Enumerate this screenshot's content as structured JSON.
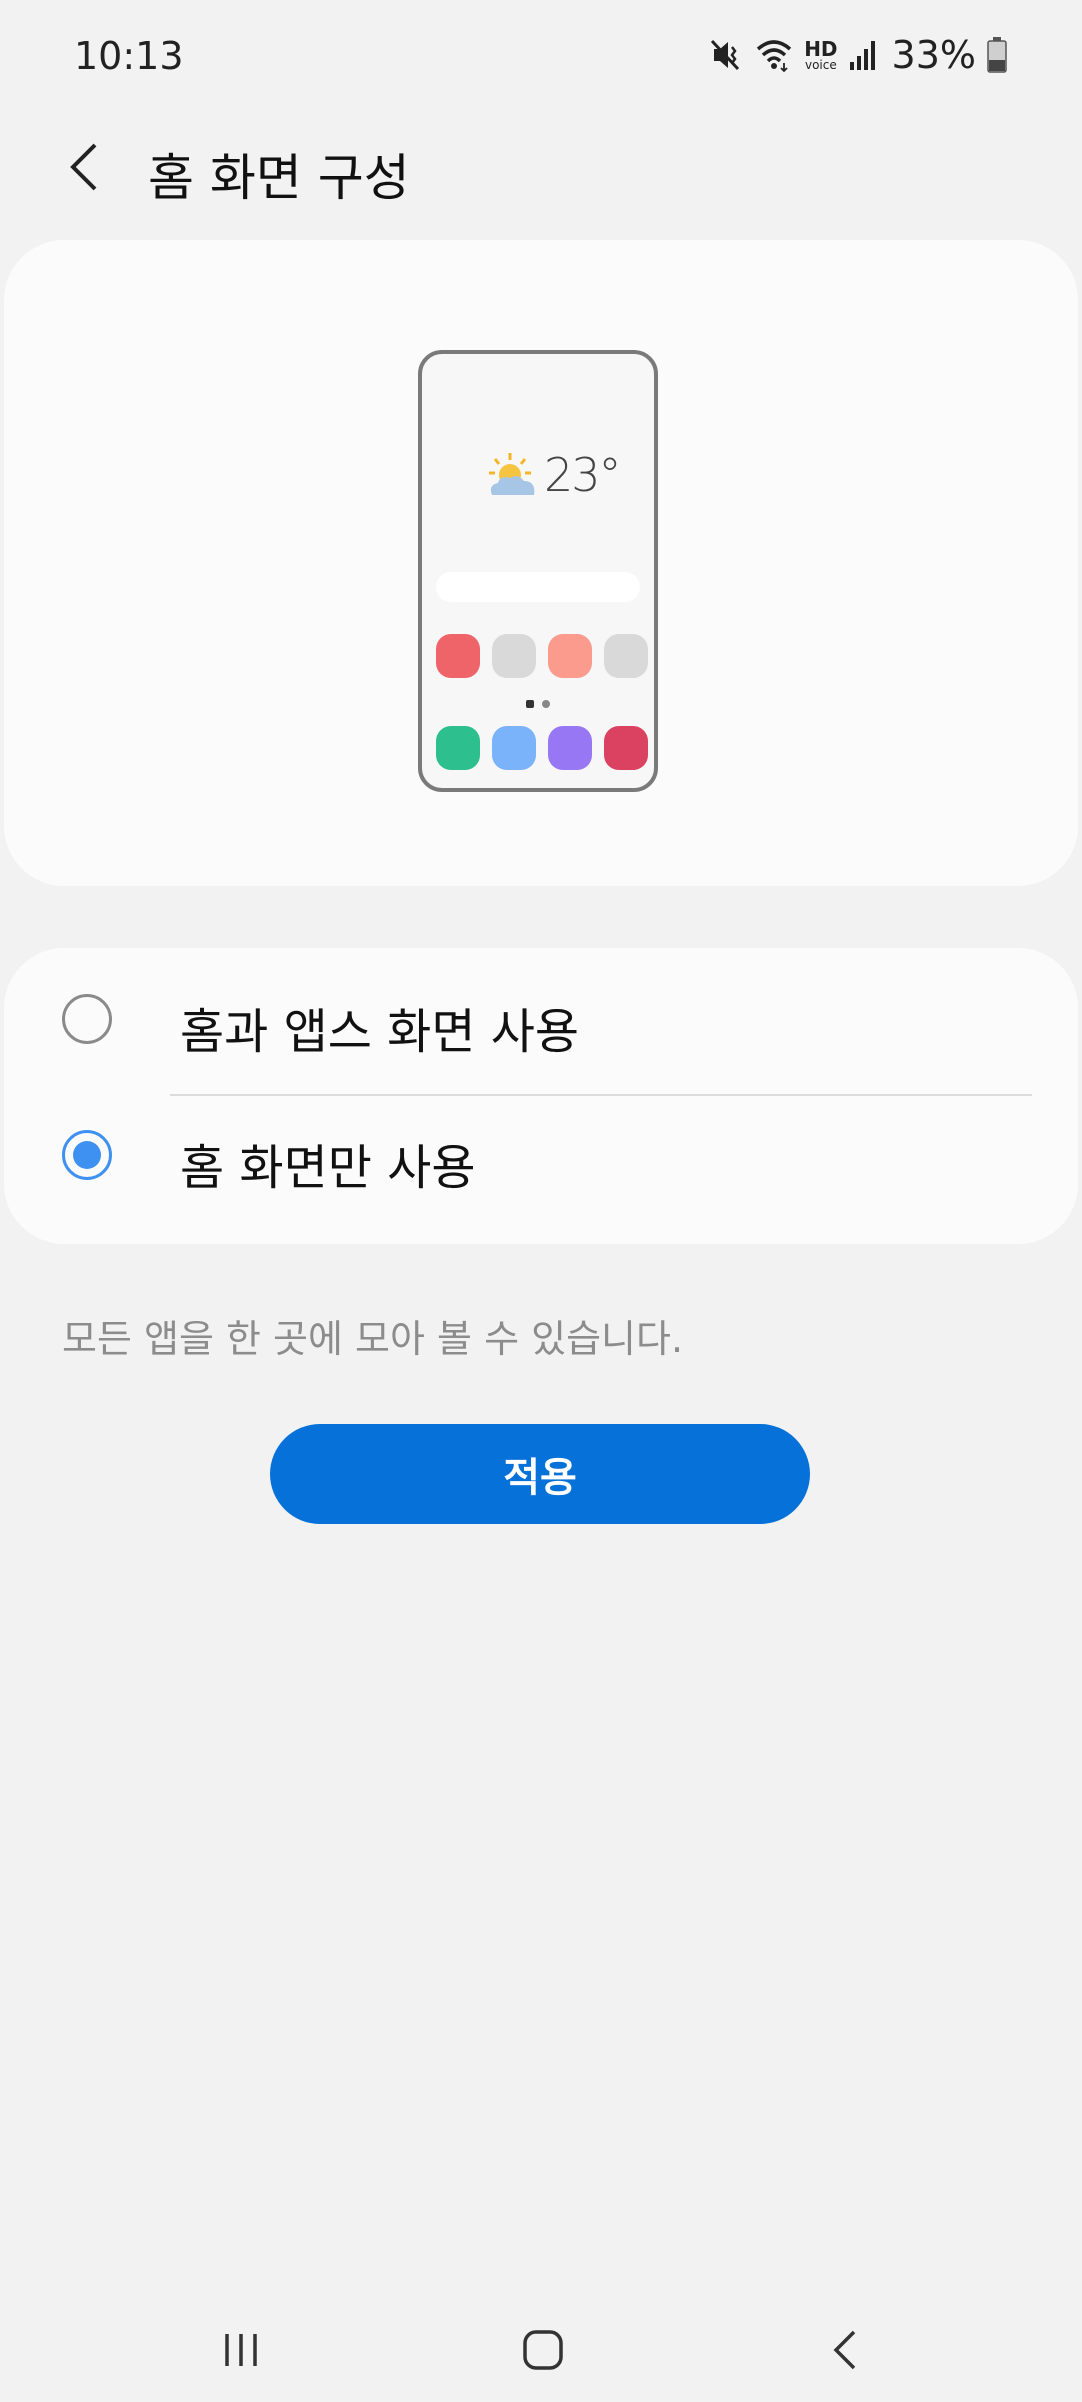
{
  "status_bar": {
    "time": "10:13",
    "hd_label": "HD",
    "voice_label": "voice",
    "battery": "33%",
    "icons": [
      "vibrate-mute-icon",
      "wifi-icon",
      "hd-voice-icon",
      "signal-icon",
      "battery-icon"
    ]
  },
  "header": {
    "back_icon": "chevron-left-icon",
    "title": "홈 화면 구성"
  },
  "preview": {
    "weather_icon": "sun-cloud-icon",
    "temperature": "23°",
    "app_colors_row1": [
      "#ee6469",
      "#d9d9d9",
      "#fa9b8d",
      "#d9d9d9"
    ],
    "app_colors_row2": [
      "#2dbf8e",
      "#7ab3fa",
      "#9877f5",
      "#db4262"
    ]
  },
  "options": {
    "items": [
      {
        "label": "홈과 앱스 화면 사용",
        "selected": false
      },
      {
        "label": "홈 화면만 사용",
        "selected": true
      }
    ]
  },
  "description": "모든 앱을 한 곳에 모아 볼 수 있습니다.",
  "apply_button": {
    "label": "적용",
    "color": "#0671d8"
  },
  "nav_bar": {
    "icons": [
      "recents-icon",
      "home-icon",
      "back-icon"
    ]
  },
  "colors": {
    "accent": "#3e91f0",
    "background": "#f2f2f2",
    "card": "#fbfbfb"
  }
}
